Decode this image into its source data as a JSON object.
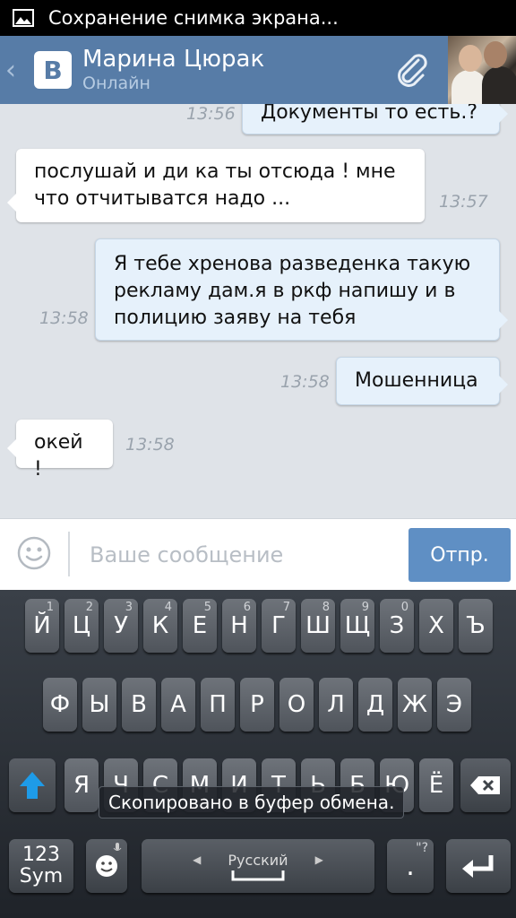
{
  "status_bar": {
    "text": "Сохранение снимка экрана..."
  },
  "header": {
    "name": "Марина Цюрак",
    "status": "Онлайн"
  },
  "messages": [
    {
      "text": "Документы то есть.?",
      "time": "13:56",
      "dir": "out"
    },
    {
      "text": "послушай и ди ка ты отсюда ! мне что отчитыватся надо ...",
      "time": "13:57",
      "dir": "in"
    },
    {
      "text": "Я тебе хренова разведенка такую рекламу дам.я в ркф напишу и в полицию заяву на тебя",
      "time": "13:58",
      "dir": "out"
    },
    {
      "text": "Мошенница",
      "time": "13:58",
      "dir": "out"
    },
    {
      "text": "окей !",
      "time": "13:58",
      "dir": "in"
    }
  ],
  "input": {
    "placeholder": "Ваше сообщение",
    "send_label": "Отпр."
  },
  "keyboard": {
    "row1": [
      {
        "l": "Й",
        "n": "1"
      },
      {
        "l": "Ц",
        "n": "2"
      },
      {
        "l": "У",
        "n": "3"
      },
      {
        "l": "К",
        "n": "4"
      },
      {
        "l": "Е",
        "n": "5"
      },
      {
        "l": "Н",
        "n": "6"
      },
      {
        "l": "Г",
        "n": "7"
      },
      {
        "l": "Ш",
        "n": "8"
      },
      {
        "l": "Щ",
        "n": "9"
      },
      {
        "l": "З",
        "n": "0"
      },
      {
        "l": "Х",
        "n": ""
      },
      {
        "l": "Ъ",
        "n": ""
      }
    ],
    "row2": [
      "Ф",
      "Ы",
      "В",
      "А",
      "П",
      "Р",
      "О",
      "Л",
      "Д",
      "Ж",
      "Э"
    ],
    "row3": [
      "Я",
      "Ч",
      "С",
      "М",
      "И",
      "Т",
      "Ь",
      "Б",
      "Ю",
      "Ё"
    ],
    "sym_label_1": "123",
    "sym_label_2": "Sym",
    "language": "Русский",
    "period": ".",
    "toast": "Скопировано в буфер обмена."
  }
}
